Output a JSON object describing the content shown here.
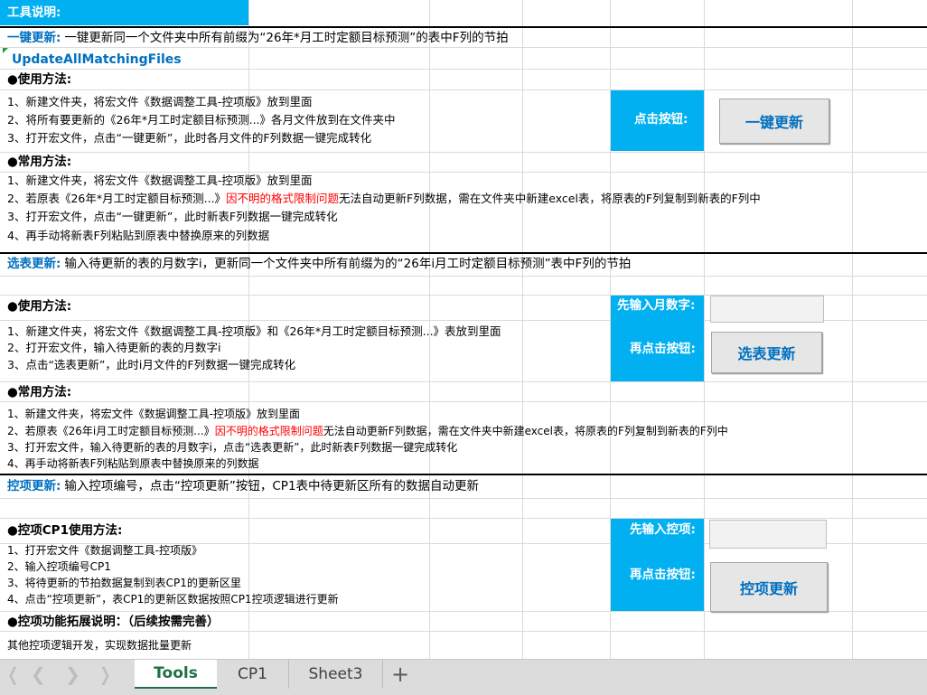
{
  "tool_header": "工具说明:",
  "section1": {
    "title": "一键更新:",
    "desc": "一键更新同一个文件夹中所有前缀为“26年*月工时定额目标预测”的表中F列的节拍",
    "macro_name": "UpdateAllMatchingFiles",
    "usage_title": "●使用方法:",
    "usage": [
      "1、新建文件夹，将宏文件《数据调整工具-控项版》放到里面",
      "2、将所有要更新的《26年*月工时定额目标预测...》各月文件放到在文件夹中",
      "3、打开宏文件，点击“一键更新”，此时各月文件的F列数据一键完成转化"
    ],
    "click_label": "点击按钮:",
    "button": "一键更新",
    "common_title": "●常用方法:",
    "common_1": "1、新建文件夹，将宏文件《数据调整工具-控项版》放到里面",
    "common_2a": "2、若原表《26年*月工时定额目标预测...》",
    "common_2red": "因不明的格式限制问题",
    "common_2b": "无法自动更新F列数据，需在文件夹中新建excel表，将原表的F列复制到新表的F列中",
    "common_3": "3、打开宏文件，点击“一键更新”，此时新表F列数据一键完成转化",
    "common_4": "4、再手动将新表F列粘贴到原表中替换原来的列数据"
  },
  "section2": {
    "title": "选表更新:",
    "desc": "输入待更新的表的月数字i，更新同一个文件夹中所有前缀为的“26年i月工时定额目标预测”表中F列的节拍",
    "usage_title": "●使用方法:",
    "usage": [
      "1、新建文件夹，将宏文件《数据调整工具-控项版》和《26年*月工时定额目标预测...》表放到里面",
      "2、打开宏文件，输入待更新的表的月数字i",
      "3、点击“选表更新”，此时i月文件的F列数据一键完成转化"
    ],
    "input_label": "先输入月数字:",
    "click_label": "再点击按钮:",
    "input_value": "",
    "button": "选表更新",
    "common_title": "●常用方法:",
    "common_1": "1、新建文件夹，将宏文件《数据调整工具-控项版》放到里面",
    "common_2a": "2、若原表《26年i月工时定额目标预测...》",
    "common_2red": "因不明的格式限制问题",
    "common_2b": "无法自动更新F列数据，需在文件夹中新建excel表，将原表的F列复制到新表的F列中",
    "common_3": "3、打开宏文件，输入待更新的表的月数字i，点击“选表更新”，此时新表F列数据一键完成转化",
    "common_4": "4、再手动将新表F列粘贴到原表中替换原来的列数据"
  },
  "section3": {
    "title": "控项更新:",
    "desc": "输入控项编号，点击“控项更新”按钮，CP1表中待更新区所有的数据自动更新",
    "usage_title": "●控项CP1使用方法:",
    "usage": [
      "1、打开宏文件《数据调整工具-控项版》",
      "2、输入控项编号CP1",
      "3、将待更新的节拍数据复制到表CP1的更新区里",
      "4、点击“控项更新”，表CP1的更新区数据按照CP1控项逻辑进行更新"
    ],
    "input_label": "先输入控项:",
    "click_label": "再点击按钮:",
    "input_value": "",
    "button": "控项更新",
    "ext_title": "●控项功能拓展说明：（后续按需完善）",
    "ext_desc": "其他控项逻辑开发，实现数据批量更新"
  },
  "tabs": [
    "Tools",
    "CP1",
    "Sheet3"
  ],
  "active_tab": "Tools",
  "add_sheet": "+",
  "colors": {
    "accent": "#00b0f0",
    "link_blue": "#0070c0",
    "warning_red": "#ff0000",
    "active_tab": "#1e7145"
  }
}
